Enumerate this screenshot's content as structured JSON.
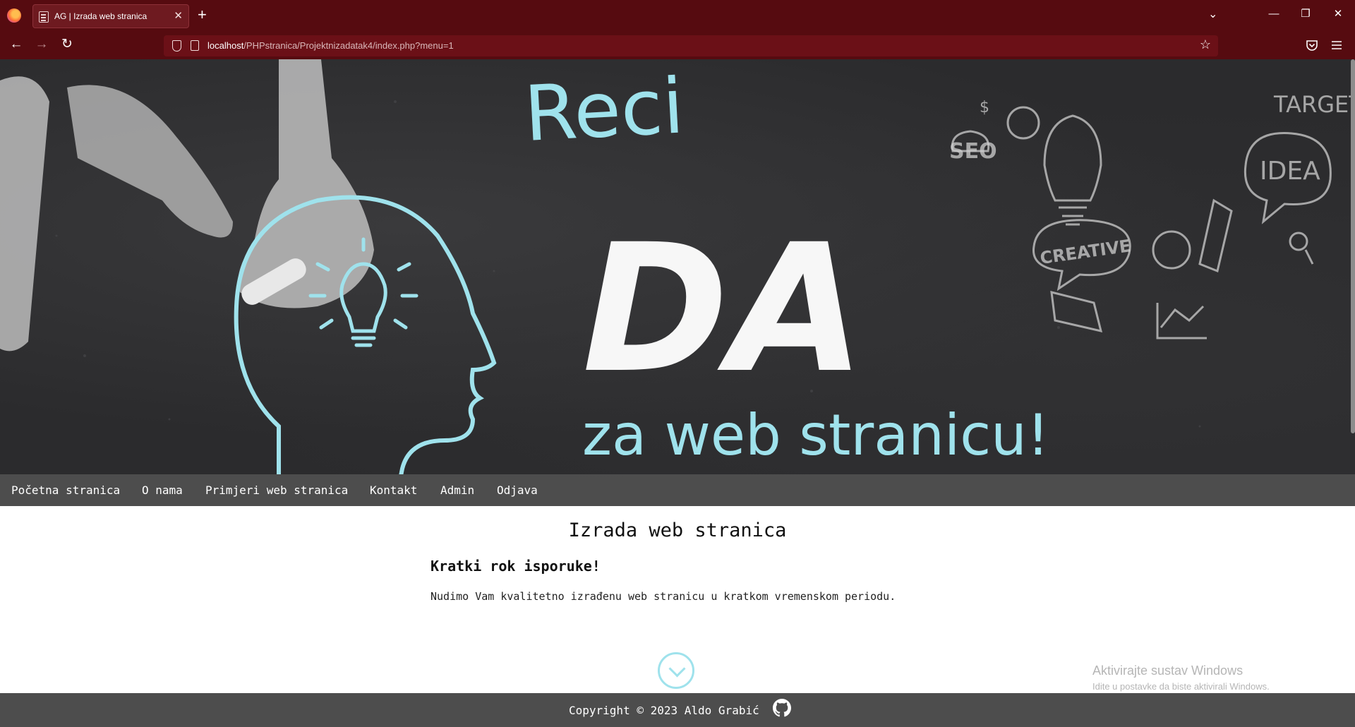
{
  "browser": {
    "tab_title": "AG | Izrada web stranica",
    "url_host": "localhost",
    "url_path": "/PHPstranica/Projektnizadatak4/index.php?menu=1"
  },
  "banner": {
    "line1": "Reci",
    "line2": "DA",
    "line3": "za web stranicu!",
    "doodles": [
      "SEO",
      "CREATIVE",
      "IDEA",
      "TARGET",
      "$"
    ]
  },
  "menu": {
    "items": [
      "Početna stranica",
      "O nama",
      "Primjeri web stranica",
      "Kontakt",
      "Admin",
      "Odjava"
    ]
  },
  "content": {
    "title": "Izrada web stranica",
    "subtitle": "Kratki rok isporuke!",
    "text": "Nudimo Vam kvalitetno izrađenu web stranicu u kratkom vremenskom periodu."
  },
  "footer": {
    "copyright": "Copyright © 2023 Aldo Grabić"
  },
  "watermark": {
    "line1": "Aktivirajte sustav Windows",
    "line2": "Idite u postavke da biste aktivirali Windows."
  },
  "colors": {
    "chrome": "#560b10",
    "menu_bg": "#4d4d4d",
    "chalk_cyan": "#9fe2ec"
  }
}
